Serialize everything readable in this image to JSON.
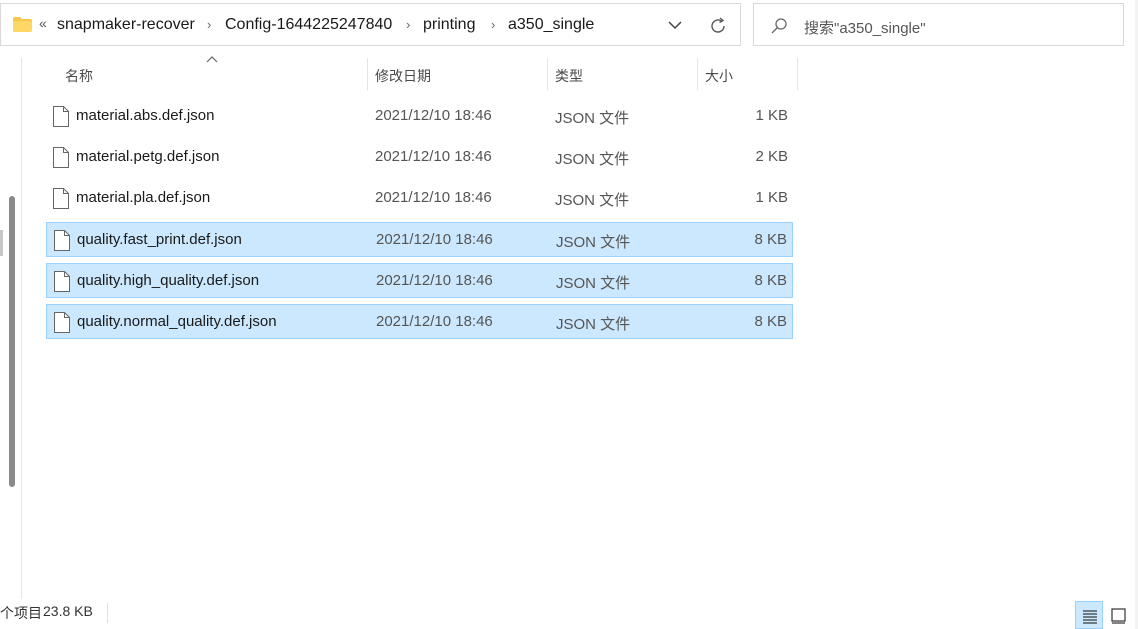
{
  "address_bar": {
    "crumbs": [
      "snapmaker-recover",
      "Config-1644225247840",
      "printing",
      "a350_single"
    ],
    "overflow_label": "«"
  },
  "search": {
    "placeholder": "搜索\"a350_single\""
  },
  "columns": {
    "name": "名称",
    "modified": "修改日期",
    "type": "类型",
    "size": "大小"
  },
  "files": [
    {
      "name": "material.abs.def.json",
      "modified": "2021/12/10 18:46",
      "type": "JSON 文件",
      "size": "1 KB",
      "selected": false
    },
    {
      "name": "material.petg.def.json",
      "modified": "2021/12/10 18:46",
      "type": "JSON 文件",
      "size": "2 KB",
      "selected": false
    },
    {
      "name": "material.pla.def.json",
      "modified": "2021/12/10 18:46",
      "type": "JSON 文件",
      "size": "1 KB",
      "selected": false
    },
    {
      "name": "quality.fast_print.def.json",
      "modified": "2021/12/10 18:46",
      "type": "JSON 文件",
      "size": "8 KB",
      "selected": true
    },
    {
      "name": "quality.high_quality.def.json",
      "modified": "2021/12/10 18:46",
      "type": "JSON 文件",
      "size": "8 KB",
      "selected": true
    },
    {
      "name": "quality.normal_quality.def.json",
      "modified": "2021/12/10 18:46",
      "type": "JSON 文件",
      "size": "8 KB",
      "selected": true
    }
  ],
  "status_bar": {
    "count_text": "个项目",
    "size_text": "23.8 KB"
  },
  "icons": {
    "folder": "folder-icon",
    "dropdown": "chevron-down-icon",
    "refresh": "refresh-icon",
    "search": "search-icon",
    "file": "file-icon",
    "sort": "sort-ascending-icon",
    "details_view": "details-view-icon",
    "tiles_view": "large-icons-view-icon"
  },
  "colors": {
    "selection_bg": "#cce8ff",
    "selection_border": "#99d1ff",
    "folder_yellow": "#f8c648"
  }
}
